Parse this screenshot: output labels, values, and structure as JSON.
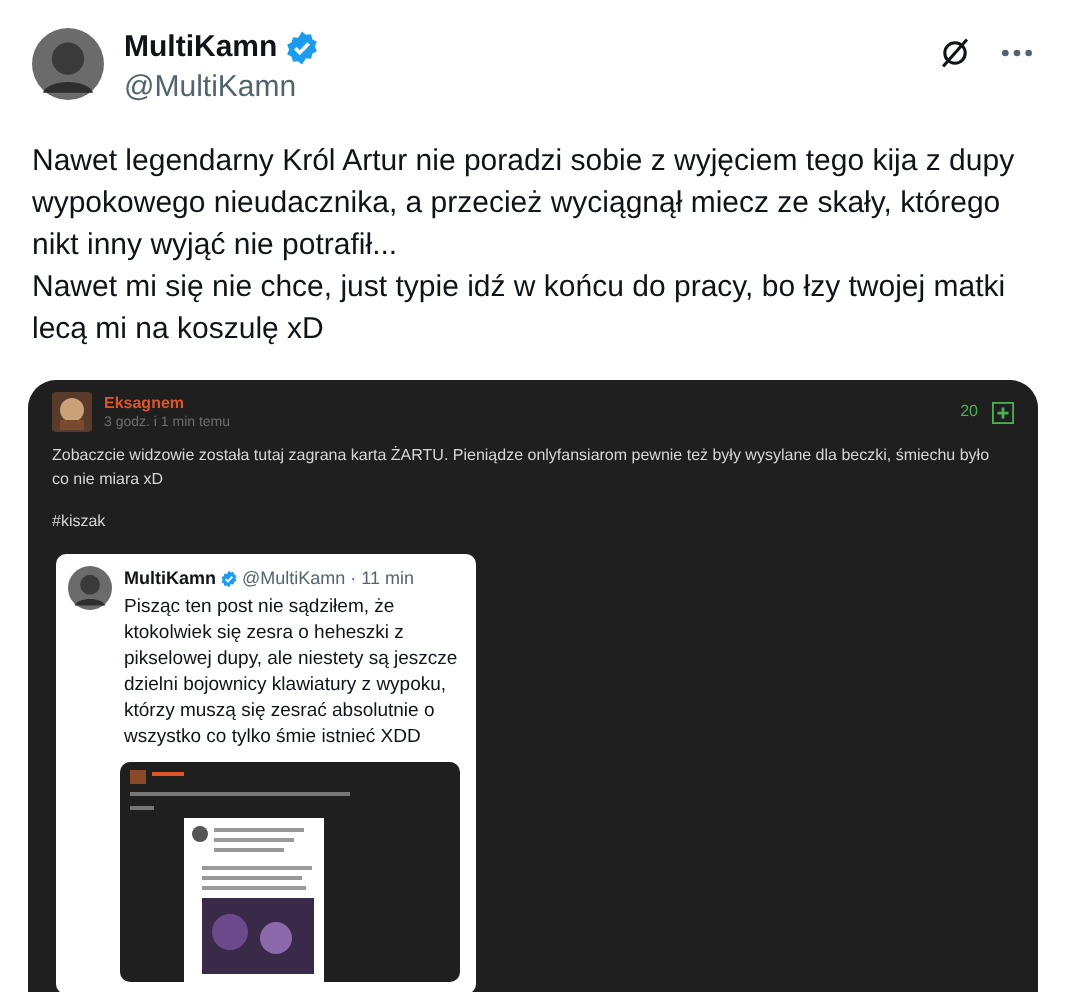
{
  "author": {
    "name": "MultiKamn",
    "verified": true,
    "handle": "@MultiKamn"
  },
  "tweet_text": [
    "Nawet legendarny Król Artur nie poradzi sobie z wyjęciem tego kija z dupy wypokowego nieudacznika, a przecież wyciągnął miecz ze skały, którego nikt inny wyjąć nie potrafił...",
    "Nawet mi się nie chce, just typie idź w końcu do pracy, bo łzy twojej matki lecą mi na koszulę xD"
  ],
  "embedded_post": {
    "username": "Eksagnem",
    "time": "3 godz. i 1 min temu",
    "votes": "20",
    "text": "Zobaczcie widzowie została tutaj zagrana karta ŻARTU. Pieniądze onlyfansiarom pewnie też były wysylane dla beczki, śmiechu było co nie miara xD",
    "tag": "#kiszak",
    "quoted_tweet": {
      "name": "MultiKamn",
      "verified": true,
      "meta": "@MultiKamn · 11 min",
      "text": "Pisząc ten post nie sądziłem, że ktokolwiek się zesra o heheszki z pikselowej dupy, ale niestety są jeszcze dzielni bojownicy klawiatury z wypoku, którzy muszą się zesrać absolutnie o wszystko co tylko śmie istnieć XDD"
    }
  }
}
